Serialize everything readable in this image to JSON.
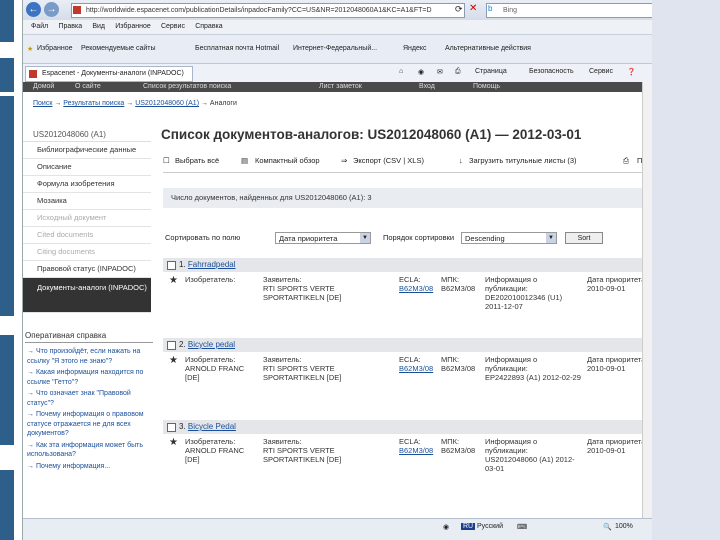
{
  "browser": {
    "url": "http://worldwide.espacenet.com/publicationDetails/inpadocFamily?CC=US&NR=2012048060A1&KC=A1&FT=D",
    "search_placeholder": "Bing",
    "menu": [
      "Файл",
      "Правка",
      "Вид",
      "Избранное",
      "Сервис",
      "Справка"
    ],
    "favorites": [
      "Избранное",
      "Рекомендуемые сайты",
      "Бесплатная почта Hotmail",
      "Интернет-Федеральный...",
      "Яндекс",
      "Альтернативные действия"
    ],
    "tab_title": "Espacenet - Документы-аналоги (INPADOC)",
    "tools": [
      "Страница",
      "Безопасность",
      "Сервис"
    ],
    "site_nav": [
      "Домой",
      "О сайте",
      "Список результатов поиска",
      "Лист заметок",
      "Вход",
      "Помощь"
    ],
    "status_lang": "Русский",
    "status_zoom": "100%"
  },
  "breadcrumb": {
    "home": "Поиск",
    "results": "Результаты поиска",
    "doc": "US2012048060 (A1)",
    "current": "Аналоги"
  },
  "sidebar": {
    "doc_id": "US2012048060 (A1)",
    "items": [
      {
        "label": "Библиографические данные",
        "state": "normal"
      },
      {
        "label": "Описание",
        "state": "normal"
      },
      {
        "label": "Формула изобретения",
        "state": "normal"
      },
      {
        "label": "Мозаика",
        "state": "normal"
      },
      {
        "label": "Исходный документ",
        "state": "disabled"
      },
      {
        "label": "Cited documents",
        "state": "disabled"
      },
      {
        "label": "Citing documents",
        "state": "disabled"
      },
      {
        "label": "Правовой статус (INPADOC)",
        "state": "normal"
      },
      {
        "label": "Документы-аналоги (INPADOC)",
        "state": "active"
      }
    ],
    "ops_title": "Оперативная справка",
    "ops_links": [
      "Что произойдёт, если нажать на ссылку \"Я этого не знаю\"?",
      "Какая информация находится по ссылке \"Гетто\"?",
      "Что означает знак \"Правовой статус\"?",
      "Почему информация о правовом статусе отражается не для всех документов?",
      "Как эта информация может быть использована?",
      "Почему информация..."
    ]
  },
  "page": {
    "title": "Список документов-аналогов: US2012048060 (A1) — 2012-03-01",
    "toolbar": {
      "select_all": "Выбрать всё",
      "compact": "Компактный обзор",
      "export": "Экспорт (CSV | XLS)",
      "download": "Загрузить титульные листы (3)",
      "print": "Печать"
    },
    "info": "Число документов, найденных для US2012048060 (A1): 3",
    "sort": {
      "label": "Сортировать по полю",
      "field": "Дата приоритета",
      "order_label": "Порядок сортировки",
      "order": "Descending",
      "button": "Sort"
    }
  },
  "results": [
    {
      "num": "1.",
      "title": "Fahrradpedal",
      "inventors_label": "Изобретатель:",
      "inventors": "",
      "applicant_label": "Заявитель:",
      "applicant": "RTI SPORTS VERTE SPORTARTIKELN [DE]",
      "ecla_label": "ECLA:",
      "ecla": "B62M3/08",
      "ipc_label": "МПК:",
      "ipc": "B62M3/08",
      "pub_label": "Информация о публикации:",
      "pub": "DE202010012346 (U1) 2011-12-07",
      "prio_label": "Дата приоритета:",
      "prio": "2010-09-01"
    },
    {
      "num": "2.",
      "title": "Bicycle pedal",
      "inventors_label": "Изобретатель:",
      "inventors": "ARNOLD FRANC [DE]",
      "applicant_label": "Заявитель:",
      "applicant": "RTI SPORTS VERTE SPORTARTIKELN [DE]",
      "ecla_label": "ECLA:",
      "ecla": "B62M3/08",
      "ipc_label": "МПК:",
      "ipc": "B62M3/08",
      "pub_label": "Информация о публикации:",
      "pub": "EP2422893 (A1) 2012-02-29",
      "prio_label": "Дата приоритета:",
      "prio": "2010-09-01"
    },
    {
      "num": "3.",
      "title": "Bicycle Pedal",
      "inventors_label": "Изобретатель:",
      "inventors": "ARNOLD FRANC [DE]",
      "applicant_label": "Заявитель:",
      "applicant": "RTI SPORTS VERTE SPORTARTIKELN [DE]",
      "ecla_label": "ECLA:",
      "ecla": "B62M3/08",
      "ipc_label": "МПК:",
      "ipc": "B62M3/08",
      "pub_label": "Информация о публикации:",
      "pub": "US2012048060 (A1) 2012-03-01",
      "prio_label": "Дата приоритета:",
      "prio": "2010-09-01"
    }
  ]
}
